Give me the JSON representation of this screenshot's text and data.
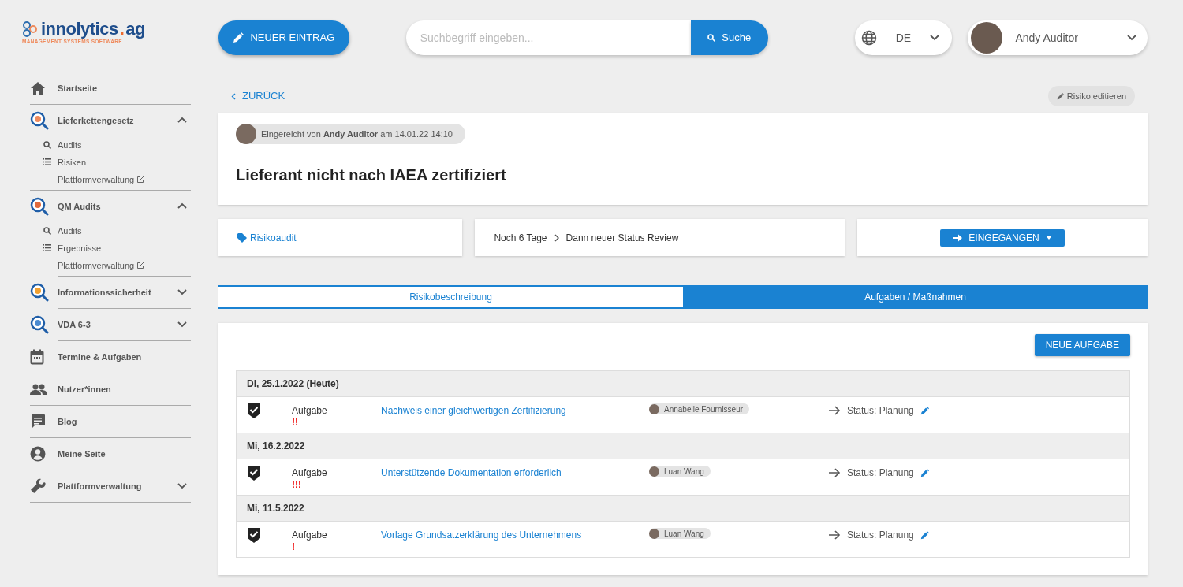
{
  "logo": {
    "parts": [
      "innolytics",
      ".",
      "ag"
    ],
    "tagline": "MANAGEMENT SYSTEMS SOFTWARE"
  },
  "sidebar": {
    "items": [
      {
        "label": "Startseite"
      },
      {
        "label": "Lieferkettengesetz",
        "expanded": true,
        "children": [
          {
            "label": "Audits",
            "kind": "search"
          },
          {
            "label": "Risiken",
            "kind": "list"
          },
          {
            "label": "Plattformverwaltung",
            "kind": "external"
          }
        ]
      },
      {
        "label": "QM Audits",
        "expanded": true,
        "children": [
          {
            "label": "Audits",
            "kind": "search"
          },
          {
            "label": "Ergebnisse",
            "kind": "list"
          },
          {
            "label": "Plattformverwaltung",
            "kind": "external"
          }
        ]
      },
      {
        "label": "Informationssicherheit",
        "expanded": false
      },
      {
        "label": "VDA 6-3",
        "expanded": false
      },
      {
        "label": "Termine & Aufgaben"
      },
      {
        "label": "Nutzer*innen"
      },
      {
        "label": "Blog"
      },
      {
        "label": "Meine Seite"
      },
      {
        "label": "Plattformverwaltung",
        "expanded": false
      }
    ]
  },
  "topbar": {
    "new_entry": "NEUER EINTRAG",
    "search": {
      "placeholder": "Suchbegriff eingeben...",
      "button": "Suche"
    },
    "language": "DE",
    "user": "Andy Auditor"
  },
  "back": "ZURÜCK",
  "edit_button": "Risiko editieren",
  "header": {
    "submitted": "Eingereicht von **Andy Auditor** am 14.01.22 14:10",
    "title": "Lieferant nicht nach IAEA zertifiziert"
  },
  "info": {
    "tag": "Risikoaudit",
    "countdown": "Noch 6 Tage",
    "next": "Dann neuer Status Review",
    "status_button": "EINGEGANGEN"
  },
  "tabs": [
    {
      "label": "Risikobeschreibung",
      "selected": false
    },
    {
      "label": "Aufgaben / Maßnahmen",
      "selected": true
    }
  ],
  "new_task": "NEUE AUFGABE",
  "task_groups": [
    {
      "date": "Di, 25.1.2022 (Heute)",
      "tasks": [
        {
          "type": "Aufgabe",
          "priority": "!!",
          "title": "Nachweis einer gleichwertigen Zertifizierung",
          "assignee": "Annabelle Fournisseur",
          "status": "Status: Planung"
        }
      ]
    },
    {
      "date": "Mi, 16.2.2022",
      "tasks": [
        {
          "type": "Aufgabe",
          "priority": "!!!",
          "title": "Unterstützende Dokumentation erforderlich",
          "assignee": "Luan Wang",
          "status": "Status: Planung"
        }
      ]
    },
    {
      "date": "Mi, 11.5.2022",
      "tasks": [
        {
          "type": "Aufgabe",
          "priority": "!",
          "title": "Vorlage Grundsatzerklärung des Unternehmens",
          "assignee": "Luan Wang",
          "status": "Status: Planung"
        }
      ]
    }
  ]
}
